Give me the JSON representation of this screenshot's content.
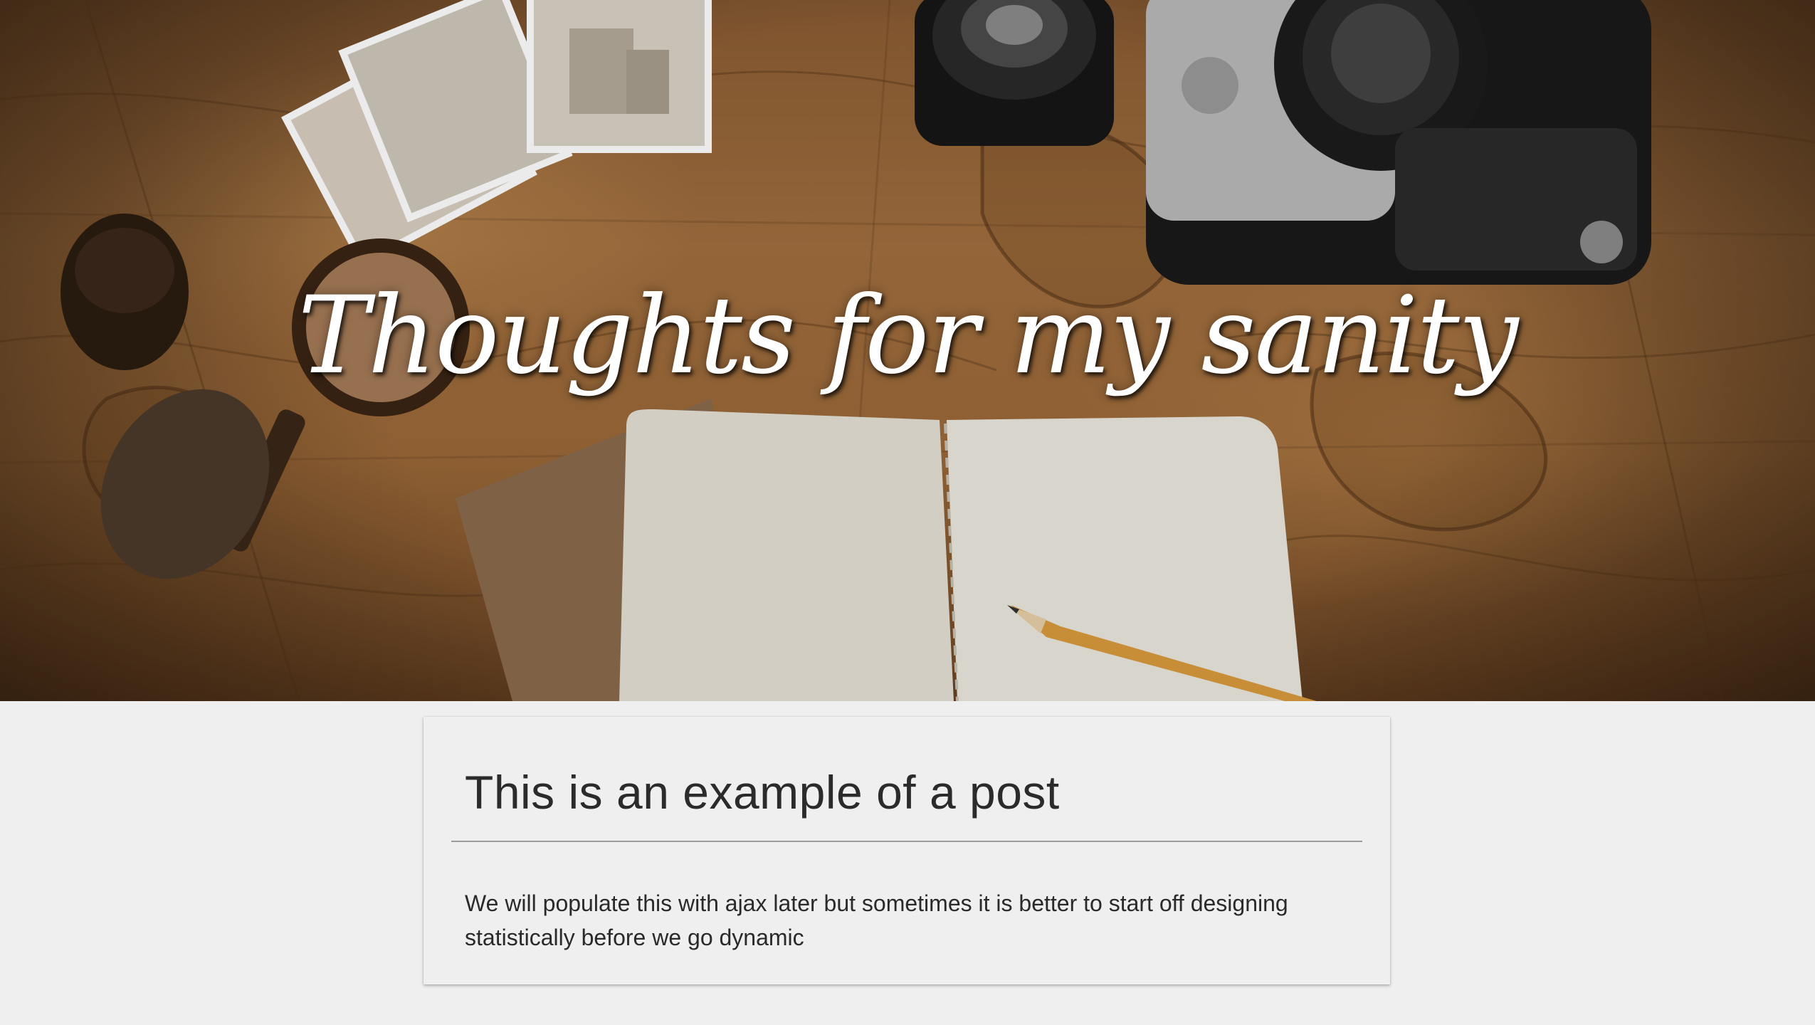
{
  "hero": {
    "title": "Thoughts for my sanity",
    "background_theme": "vintage map with camera, notebook, pencil, magnifying glass and postcards",
    "title_color": "#ffffff"
  },
  "post": {
    "title": "This is an example of a post",
    "body": "We will populate this with ajax later but sometimes it is better to start off designing statistically before we go dynamic"
  },
  "colors": {
    "page_background": "#efefef",
    "text": "#2b2b2b",
    "divider": "#9c9c9c"
  }
}
